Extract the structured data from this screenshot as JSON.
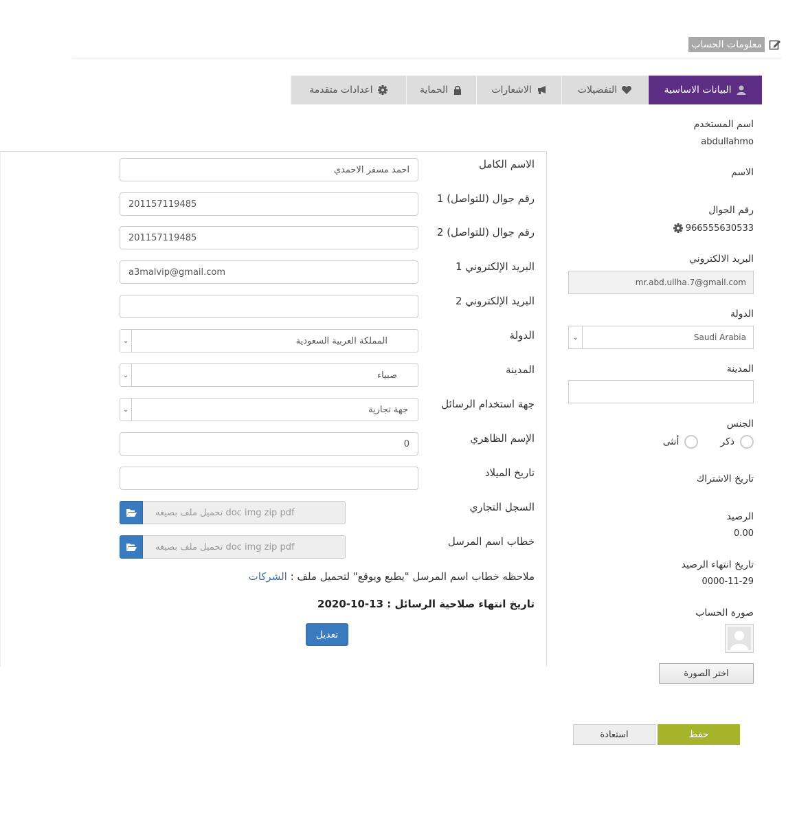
{
  "header": {
    "title": "معلومات الحساب",
    "icon": "edit-icon"
  },
  "tabs": [
    {
      "label": "البيانات الاساسية",
      "icon": "user-icon",
      "active": true
    },
    {
      "label": "التفضيلات",
      "icon": "heart-icon",
      "active": false
    },
    {
      "label": "الاشعارات",
      "icon": "megaphone-icon",
      "active": false
    },
    {
      "label": "الحماية",
      "icon": "lock-icon",
      "active": false
    },
    {
      "label": "اعدادات متقدمة",
      "icon": "gear-icon",
      "active": false
    }
  ],
  "profile": {
    "username_label": "اسم المستخدم",
    "username": "abdullahmo",
    "name_label": "الاسم",
    "mobile_label": "رقم الجوال",
    "mobile": "966555630533",
    "email_label": "البريد الالكتروني",
    "email": "mr.abd.ullha.7@gmail.com",
    "country_label": "الدولة",
    "country": "Saudi Arabia",
    "city_label": "المدينة",
    "city": "",
    "gender_label": "الجنس",
    "gender_male": "ذكر",
    "gender_female": "أنثى",
    "subscription_label": "تاريخ الاشتراك",
    "balance_label": "الرصيد",
    "balance": "0.00",
    "balance_expiry_label": "تاريخ انتهاء الرصيد",
    "balance_expiry": "0000-11-29",
    "photo_label": "صورة الحساب",
    "choose_photo": "اختر الصورة"
  },
  "form": {
    "fullname_label": "الاسم الكامل",
    "fullname": "احمد مسفر الاحمدي",
    "mobile1_label": "رقم جوال (للتواصل) 1",
    "mobile1": "201157119485",
    "mobile2_label": "رقم جوال (للتواصل) 2",
    "mobile2": "201157119485",
    "email1_label": "البريد الإلكتروني 1",
    "email1": "a3malvip@gmail.com",
    "email2_label": "البريد الإلكتروني 2",
    "email2": "",
    "country_label": "الدولة",
    "country": "المملكة العربية السعودية",
    "city_label": "المدينة",
    "city": "صبياء",
    "usage_label": "جهة استخدام الرسائل",
    "usage": "جهة تجارية",
    "display_name_label": "الإسم الظاهري",
    "display_name": "0",
    "birthdate_label": "تاريخ الميلاد",
    "birthdate": "",
    "commercial_label": "السجل التجاري",
    "commercial_placeholder": "تحميل ملف  بصيغه  doc img zip pdf",
    "sender_letter_label": "خطاب اسم المرسل",
    "sender_letter_placeholder": "تحميل ملف  بصيغه  doc img zip pdf",
    "note_text": "ملاحظه خطاب اسم المرسل \"يطبع ويوقع\" لتحميل ملف :",
    "note_link": "الشركات",
    "expiry_text": "تاريخ انتهاء صلاحية الرسائل : 13-10-2020",
    "edit_button": "تعديل"
  },
  "actions": {
    "save": "حفظ",
    "restore": "استعادة"
  },
  "colors": {
    "active_tab": "#5c2d82",
    "primary_button": "#3a7bbf",
    "save_button": "#a5b42a"
  }
}
